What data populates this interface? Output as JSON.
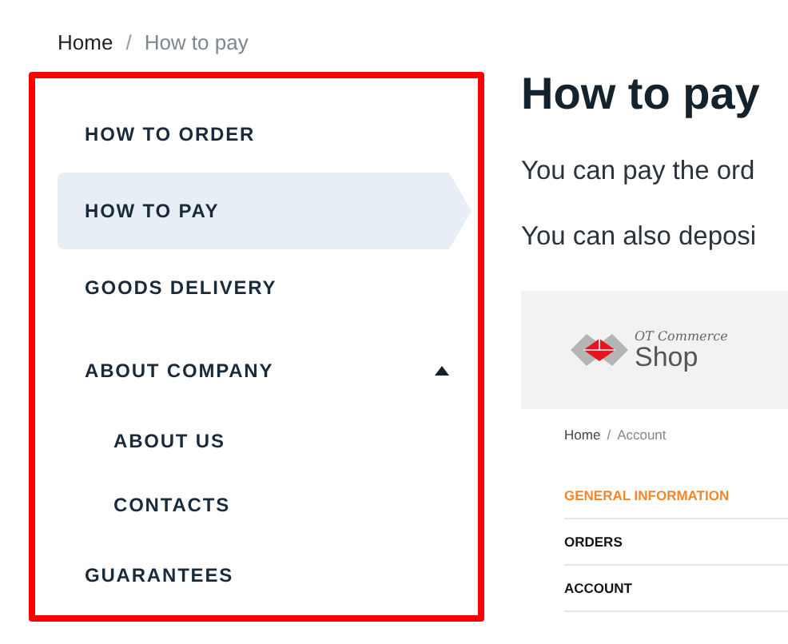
{
  "breadcrumb_separator": "/",
  "breadcrumb": [
    {
      "label": "Home",
      "current": false
    },
    {
      "label": "How to pay",
      "current": true
    }
  ],
  "sidebar": {
    "items": [
      {
        "label": "HOW TO ORDER",
        "selected": false
      },
      {
        "label": "HOW TO PAY",
        "selected": true
      },
      {
        "label": "GOODS DELIVERY",
        "selected": false
      },
      {
        "label": "ABOUT COMPANY",
        "selected": false,
        "expanded": true,
        "children": [
          {
            "label": "ABOUT US",
            "selected": false
          },
          {
            "label": "CONTACTS",
            "selected": false
          }
        ]
      },
      {
        "label": "GUARANTEES",
        "selected": false
      }
    ]
  },
  "content": {
    "title": "How to pay",
    "paragraphs": [
      "You can pay the ord",
      "You can also deposi"
    ],
    "screenshot": {
      "logo_small": "OT Commerce",
      "logo_large": "Shop",
      "breadcrumb_separator": "/",
      "breadcrumb": [
        "Home",
        "Account"
      ],
      "menu": [
        {
          "label": "GENERAL INFORMATION",
          "selected": true
        },
        {
          "label": "ORDERS",
          "selected": false
        },
        {
          "label": "ACCOUNT",
          "selected": false
        }
      ]
    }
  }
}
